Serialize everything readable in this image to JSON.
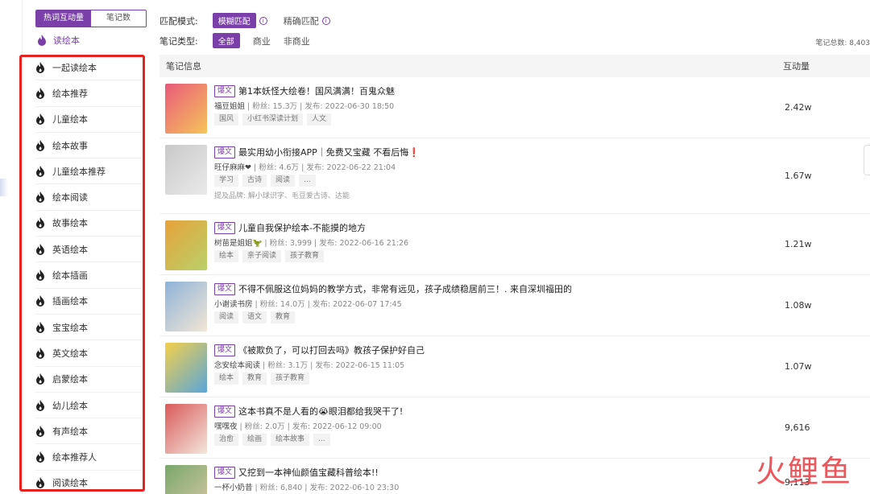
{
  "sidebar": {
    "tabs": [
      "热词互动量",
      "笔记数"
    ],
    "selected": "读绘本",
    "keywords": [
      "一起读绘本",
      "绘本推荐",
      "儿童绘本",
      "绘本故事",
      "儿童绘本推荐",
      "绘本阅读",
      "故事绘本",
      "英语绘本",
      "绘本插画",
      "插画绘本",
      "宝宝绘本",
      "英文绘本",
      "启蒙绘本",
      "幼儿绘本",
      "有声绘本",
      "绘本推荐人",
      "阅读绘本"
    ]
  },
  "filters": {
    "match_label": "匹配模式:",
    "match_fuzzy": "模糊匹配",
    "match_exact": "精确匹配",
    "type_label": "笔记类型:",
    "type_all": "全部",
    "type_commercial": "商业",
    "type_noncommercial": "非商业",
    "total": "笔记总数: 8,403"
  },
  "table": {
    "col_info": "笔记信息",
    "col_metric": "互动量",
    "rows": [
      {
        "badge": "爆文",
        "title": "第1本妖怪大绘卷！国风满满！百鬼众魅",
        "author": "福豆姐姐",
        "fans": "粉丝: 15.3万",
        "date": "发布: 2022-06-30 18:50",
        "tags": [
          "国风",
          "小红书深读计划",
          "人文"
        ],
        "brand": "",
        "metric": "2.42w"
      },
      {
        "badge": "爆文",
        "title": "最实用幼小衔接APP｜免费又宝藏 不看后悔❗",
        "author": "旺仔麻麻❤",
        "fans": "粉丝: 4.6万",
        "date": "发布: 2022-06-22 21:04",
        "tags": [
          "学习",
          "古诗",
          "阅读",
          "..."
        ],
        "brand": "提及品牌: 解小球识字、毛豆爱古诗、达能",
        "metric": "1.67w"
      },
      {
        "badge": "爆文",
        "title": "儿童自我保护绘本-不能摸的地方",
        "author": "树苗是姐姐🦖",
        "fans": "粉丝: 3,999",
        "date": "发布: 2022-06-16 21:26",
        "tags": [
          "绘本",
          "亲子阅读",
          "孩子教育"
        ],
        "brand": "",
        "metric": "1.21w"
      },
      {
        "badge": "爆文",
        "title": "不得不佩服这位妈妈的教学方式，非常有远见，孩子成绩稳居前三！. 来自深圳福田的",
        "author": "小谢读书房",
        "fans": "粉丝: 14.0万",
        "date": "发布: 2022-06-07 17:45",
        "tags": [
          "阅读",
          "语文",
          "教育"
        ],
        "brand": "",
        "metric": "1.08w"
      },
      {
        "badge": "爆文",
        "title": "《被欺负了，可以打回去吗》教孩子保护好自己",
        "author": "念安绘本阅读",
        "fans": "粉丝: 3.1万",
        "date": "发布: 2022-06-15 11:05",
        "tags": [
          "绘本",
          "教育",
          "孩子教育"
        ],
        "brand": "",
        "metric": "1.07w"
      },
      {
        "badge": "爆文",
        "title": "这本书真不是人看的😭眼泪都给我哭干了!",
        "author": "嘿嘿夜",
        "fans": "粉丝: 2.0万",
        "date": "发布: 2022-06-12 09:00",
        "tags": [
          "治愈",
          "绘画",
          "绘本故事",
          "..."
        ],
        "brand": "",
        "metric": "9,616"
      },
      {
        "badge": "爆文",
        "title": "又挖到一本神仙颜值宝藏科普绘本!!",
        "author": "一杯小奶昔",
        "fans": "粉丝: 6,840",
        "date": "发布: 2022-06-10 23:30",
        "tags": [],
        "brand": "",
        "metric": "9,113"
      }
    ]
  },
  "watermark": "火鲤鱼",
  "colors": {
    "accent": "#7b3fa9",
    "highlight": "#e32222"
  }
}
